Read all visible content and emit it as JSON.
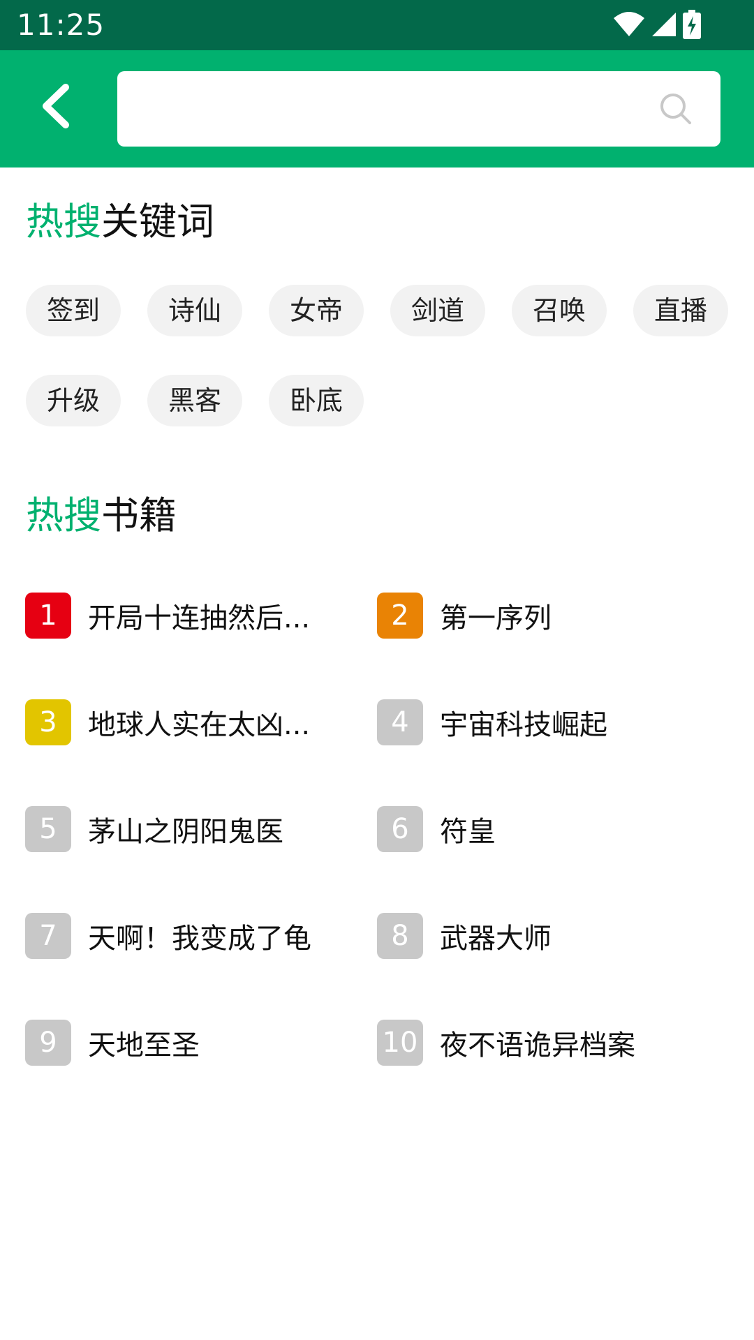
{
  "status_bar": {
    "time": "11:25",
    "icons": [
      "wifi-icon",
      "signal-icon",
      "battery-charging-icon"
    ]
  },
  "header": {
    "back_icon": "chevron-left-icon",
    "search": {
      "value": "",
      "placeholder": ""
    },
    "search_icon": "search-icon",
    "accent_color": "#01b16f",
    "status_color": "#03694a"
  },
  "hot_keywords": {
    "title_accent": "热搜",
    "title_rest": "关键词",
    "items": [
      "签到",
      "诗仙",
      "女帝",
      "剑道",
      "召唤",
      "直播",
      "升级",
      "黑客",
      "卧底"
    ]
  },
  "hot_books": {
    "title_accent": "热搜",
    "title_rest": "书籍",
    "items": [
      {
        "rank": "1",
        "title": "开局十连抽然后...",
        "badge_color": "#e60012"
      },
      {
        "rank": "2",
        "title": "第一序列",
        "badge_color": "#e98305"
      },
      {
        "rank": "3",
        "title": "地球人实在太凶...",
        "badge_color": "#e2c500"
      },
      {
        "rank": "4",
        "title": "宇宙科技崛起",
        "badge_color": "#c8c8c8"
      },
      {
        "rank": "5",
        "title": "茅山之阴阳鬼医",
        "badge_color": "#c8c8c8"
      },
      {
        "rank": "6",
        "title": "符皇",
        "badge_color": "#c8c8c8"
      },
      {
        "rank": "7",
        "title": "天啊！我变成了龟",
        "badge_color": "#c8c8c8"
      },
      {
        "rank": "8",
        "title": "武器大师",
        "badge_color": "#c8c8c8"
      },
      {
        "rank": "9",
        "title": "天地至圣",
        "badge_color": "#c8c8c8"
      },
      {
        "rank": "10",
        "title": "夜不语诡异档案",
        "badge_color": "#c8c8c8"
      }
    ]
  }
}
